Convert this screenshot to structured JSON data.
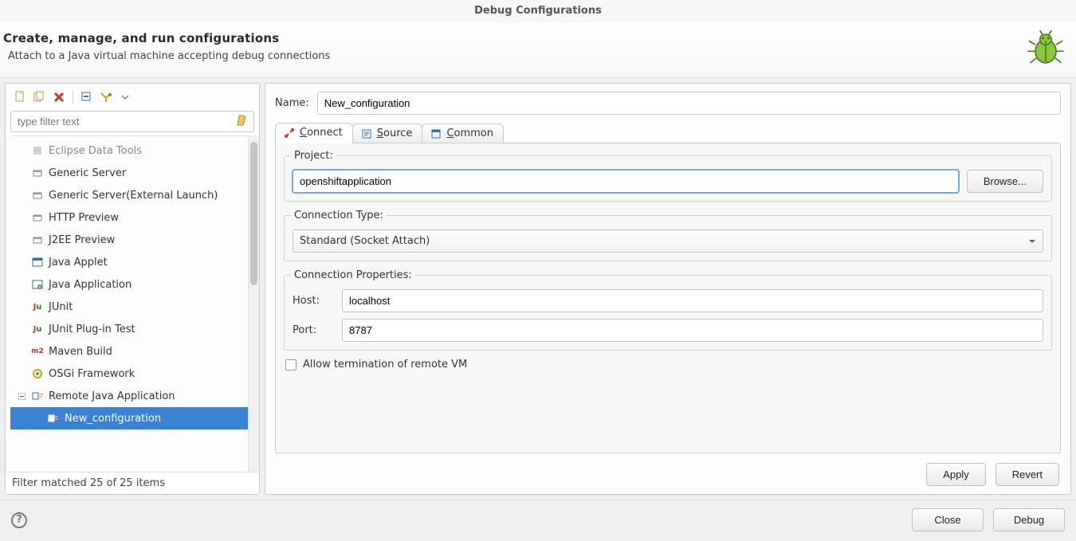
{
  "window": {
    "title": "Debug Configurations"
  },
  "header": {
    "title": "Create, manage, and run configurations",
    "subtitle": "Attach to a Java virtual machine accepting debug connections"
  },
  "left": {
    "filter_placeholder": "type filter text",
    "items": [
      {
        "label": "Eclipse Data Tools",
        "icon": "generic",
        "cut": true
      },
      {
        "label": "Generic Server",
        "icon": "server"
      },
      {
        "label": "Generic Server(External Launch)",
        "icon": "server"
      },
      {
        "label": "HTTP Preview",
        "icon": "server"
      },
      {
        "label": "J2EE Preview",
        "icon": "server"
      },
      {
        "label": "Java Applet",
        "icon": "applet"
      },
      {
        "label": "Java Application",
        "icon": "javaapp"
      },
      {
        "label": "JUnit",
        "icon": "junit"
      },
      {
        "label": "JUnit Plug-in Test",
        "icon": "junit"
      },
      {
        "label": "Maven Build",
        "icon": "maven"
      },
      {
        "label": "OSGi Framework",
        "icon": "osgi"
      },
      {
        "label": "Remote Java Application",
        "icon": "remote",
        "expandable": true,
        "expanded": true
      },
      {
        "label": "New_configuration",
        "icon": "remote-child",
        "child": true,
        "selected": true
      }
    ],
    "status": "Filter matched 25 of 25 items"
  },
  "right": {
    "name_label": "Name:",
    "name_value": "New_configuration",
    "tabs": [
      {
        "label": "Connect",
        "mnemonic": "C",
        "icon": "connect",
        "active": true
      },
      {
        "label": "Source",
        "mnemonic": "S",
        "icon": "source"
      },
      {
        "label": "Common",
        "mnemonic": "C",
        "icon": "common"
      }
    ],
    "project": {
      "legend": "Project:",
      "value": "openshiftapplication",
      "browse": "Browse..."
    },
    "conn_type": {
      "legend": "Connection Type:",
      "value": "Standard (Socket Attach)"
    },
    "conn_props": {
      "legend": "Connection Properties:",
      "host_label": "Host:",
      "host_value": "localhost",
      "port_label": "Port:",
      "port_value": "8787"
    },
    "allow_terminate": "Allow termination of remote VM",
    "apply": "Apply",
    "revert": "Revert"
  },
  "footer": {
    "close": "Close",
    "debug": "Debug"
  }
}
